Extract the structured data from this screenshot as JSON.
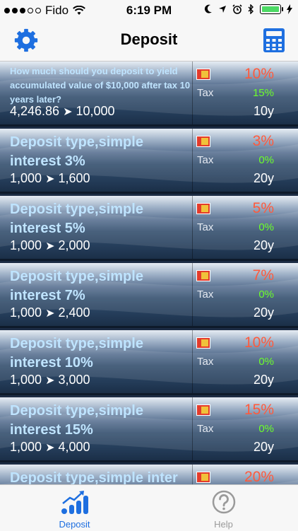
{
  "status_bar": {
    "carrier": "Fido",
    "time": "6:19 PM"
  },
  "nav": {
    "title": "Deposit",
    "left_icon": "gear-icon",
    "right_icon": "calculator-icon"
  },
  "rows": [
    {
      "title": "How much should you deposit to yield accumulated value of $10,000 after tax 10 years later?",
      "amount_from": "4,246.86",
      "amount_to": "10,000",
      "rate": "10%",
      "tax_label": "Tax",
      "tax_rate": "15%",
      "years": "10y"
    },
    {
      "title": "Deposit type,simple interest 3%",
      "amount_from": "1,000",
      "amount_to": "1,600",
      "rate": "3%",
      "tax_label": "Tax",
      "tax_rate": "0%",
      "years": "20y"
    },
    {
      "title": "Deposit type,simple interest 5%",
      "amount_from": "1,000",
      "amount_to": "2,000",
      "rate": "5%",
      "tax_label": "Tax",
      "tax_rate": "0%",
      "years": "20y"
    },
    {
      "title": "Deposit type,simple interest 7%",
      "amount_from": "1,000",
      "amount_to": "2,400",
      "rate": "7%",
      "tax_label": "Tax",
      "tax_rate": "0%",
      "years": "20y"
    },
    {
      "title": "Deposit type,simple interest 10%",
      "amount_from": "1,000",
      "amount_to": "3,000",
      "rate": "10%",
      "tax_label": "Tax",
      "tax_rate": "0%",
      "years": "20y"
    },
    {
      "title": "Deposit type,simple interest 15%",
      "amount_from": "1,000",
      "amount_to": "4,000",
      "rate": "15%",
      "tax_label": "Tax",
      "tax_rate": "0%",
      "years": "20y"
    },
    {
      "title": "Deposit type,simple inter",
      "rate": "20%"
    }
  ],
  "tabs": [
    {
      "label": "Deposit",
      "icon": "bar-chart-icon",
      "active": true
    },
    {
      "label": "Help",
      "icon": "help-icon",
      "active": false
    }
  ],
  "colors": {
    "accent": "#1e6fe0",
    "rate": "#ff5a3c",
    "tax_rate": "#6cff2a",
    "title": "#bfe4ff"
  }
}
